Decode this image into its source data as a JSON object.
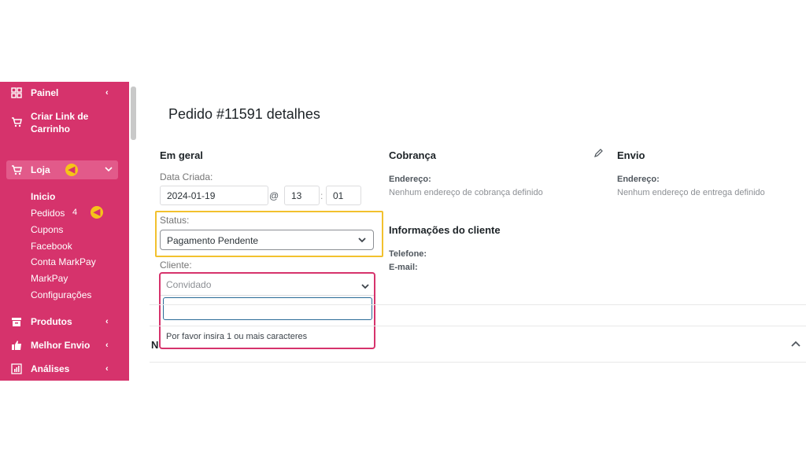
{
  "sidebar": {
    "items": [
      {
        "label": "Painel",
        "icon": "dashboard-grid-icon",
        "chevron": "‹"
      },
      {
        "label": "Criar Link de Carrinho",
        "icon": "cart-icon"
      },
      {
        "label": "Loja",
        "icon": "cart-icon",
        "chevron": "⌄"
      },
      {
        "label": "Produtos",
        "icon": "archive-icon",
        "chevron": "‹"
      },
      {
        "label": "Melhor Envio",
        "icon": "thumbs-up-icon",
        "chevron": "‹"
      },
      {
        "label": "Análises",
        "icon": "bar-chart-icon",
        "chevron": "‹"
      }
    ],
    "criar_line1": "Criar Link de",
    "criar_line2": "Carrinho",
    "loja_sub": [
      "Inicio",
      "Pedidos",
      "Cupons",
      "Facebook",
      "Conta MarkPay",
      "MarkPay",
      "Configurações"
    ],
    "pedidos_count": "4"
  },
  "pointer_glyph": "◀",
  "page": {
    "title": "Pedido #11591 detalhes"
  },
  "geral": {
    "title": "Em geral",
    "date_label": "Data Criada:",
    "date_value": "2024-01-19",
    "at": "@",
    "hour": "13",
    "colon": ":",
    "minute": "01",
    "status_label": "Status:",
    "status_value": "Pagamento Pendente",
    "cliente_label": "Cliente:",
    "cliente_placeholder": "Convidado",
    "search_hint": "Por favor insira 1 ou mais caracteres"
  },
  "cobranca": {
    "title": "Cobrança",
    "address_label": "Endereço:",
    "address_value": "Nenhum endereço de cobrança definido",
    "client_info_title": "Informações do cliente",
    "phone_label": "Telefone:",
    "email_label": "E-mail:"
  },
  "envio": {
    "title": "Envio",
    "address_label": "Endereço:",
    "address_value": "Nenhum endereço de entrega definido"
  },
  "lower_section_initial": "N",
  "colors": {
    "sidebar": "#d6336c",
    "highlight_status": "#f2c12e",
    "highlight_cliente": "#d6336c",
    "pointer": "#f6c419"
  }
}
